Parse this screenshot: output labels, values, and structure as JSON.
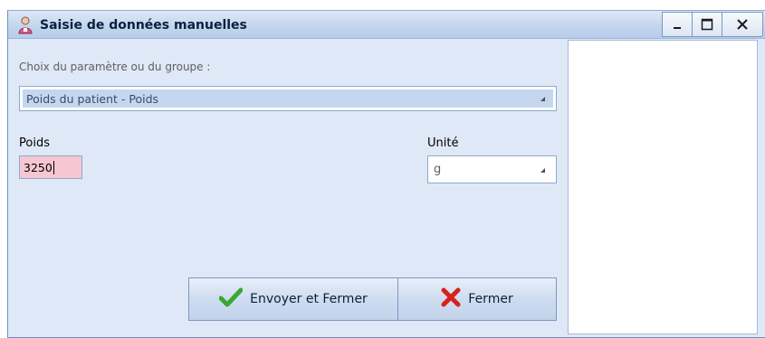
{
  "window": {
    "title": "Saisie de données manuelles",
    "icon": "user-icon"
  },
  "titlebar_buttons": {
    "minimize_icon": "minimize-icon",
    "maximize_icon": "maximize-icon",
    "close_icon": "close-icon"
  },
  "form": {
    "param_label": "Choix du paramètre ou du groupe :",
    "param_value": "Poids du patient - Poids",
    "value_label": "Poids",
    "value": "3250",
    "unit_label": "Unité",
    "unit_value": "g"
  },
  "buttons": {
    "send_label": "Envoyer et Fermer",
    "send_icon": "checkmark-icon",
    "close_label": "Fermer",
    "close_icon": "x-icon"
  },
  "colors": {
    "send_icon": "#3aa635",
    "close_icon": "#d8201c",
    "input_highlight": "#f6c7d3",
    "selection": "#c5d7ee"
  }
}
